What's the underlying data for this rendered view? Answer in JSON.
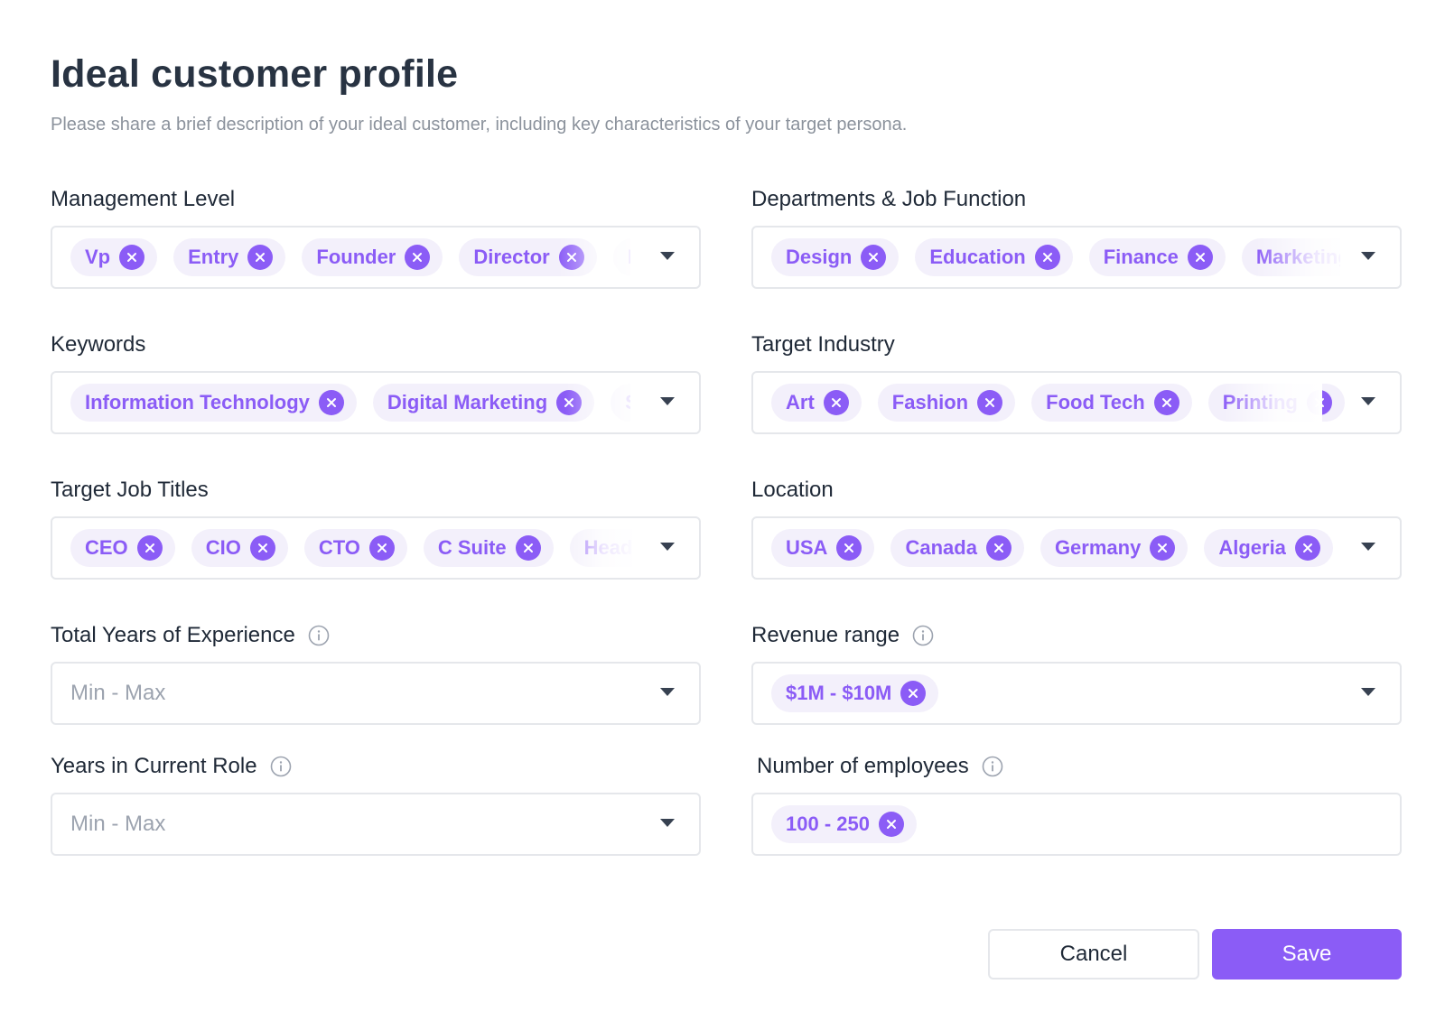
{
  "header": {
    "title": "Ideal customer profile",
    "subtitle": "Please share a brief description of your ideal customer, including key characteristics of your target persona."
  },
  "fields": {
    "management_level": {
      "label": "Management Level",
      "chips": [
        "Vp",
        "Entry",
        "Founder",
        "Director",
        "Manager"
      ]
    },
    "departments": {
      "label": "Departments & Job Function",
      "chips": [
        "Design",
        "Education",
        "Finance",
        "Marketing"
      ]
    },
    "keywords": {
      "label": "Keywords",
      "chips": [
        "Information Technology",
        "Digital Marketing",
        "SaaS"
      ]
    },
    "target_industry": {
      "label": "Target Industry",
      "chips": [
        "Art",
        "Fashion",
        "Food Tech",
        "Printing"
      ]
    },
    "target_job_titles": {
      "label": "Target Job Titles",
      "chips": [
        "CEO",
        "CIO",
        "CTO",
        "C Suite",
        "Head"
      ]
    },
    "location": {
      "label": "Location",
      "chips": [
        "USA",
        "Canada",
        "Germany",
        "Algeria"
      ]
    },
    "total_years_experience": {
      "label": "Total Years of Experience",
      "placeholder": "Min - Max"
    },
    "revenue_range": {
      "label": "Revenue range",
      "chips": [
        "$1M - $10M"
      ]
    },
    "years_current_role": {
      "label": "Years in Current Role",
      "placeholder": "Min - Max"
    },
    "number_of_employees": {
      "label": "Number of employees",
      "chips": [
        "100 - 250"
      ]
    }
  },
  "actions": {
    "cancel_label": "Cancel",
    "save_label": "Save"
  },
  "colors": {
    "accent": "#8b5cf6",
    "chip_bg": "#f3f0fb",
    "border": "#e5e7eb",
    "title": "#283342"
  },
  "icons": {
    "remove": "x-circle-icon",
    "dropdown": "chevron-down-icon",
    "info": "info-icon"
  }
}
